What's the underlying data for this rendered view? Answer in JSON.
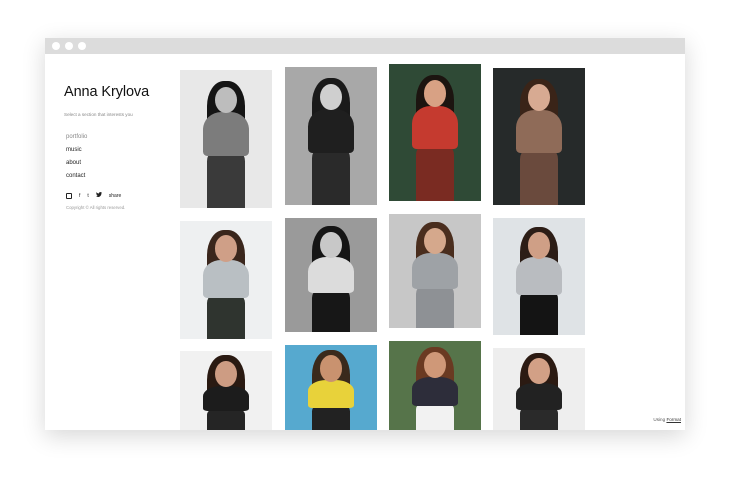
{
  "site": {
    "title": "Anna Krylova",
    "tagline": "Select a section that interests you"
  },
  "nav": {
    "items": [
      {
        "label": "portfolio",
        "active": true
      },
      {
        "label": "music",
        "active": false
      },
      {
        "label": "about",
        "active": false
      },
      {
        "label": "contact",
        "active": false
      }
    ]
  },
  "social": {
    "icons": [
      "instagram-icon",
      "facebook-icon",
      "tumblr-icon",
      "twitter-icon"
    ],
    "facebook_glyph": "f",
    "tumblr_glyph": "t",
    "share_label": "share"
  },
  "copyright": "Copyright © All rights reserved.",
  "footer": {
    "using_label": "Using",
    "platform_link": "Format"
  },
  "gallery": {
    "photos": [
      {
        "bg": "#e8e8e8",
        "body": "#7c7c7c",
        "legs": "#3a3a3a",
        "hair": "#151515",
        "skin": "#bdbdbd"
      },
      {
        "bg": "#a8a8a8",
        "body": "#1f1f1f",
        "legs": "#2a2a2a",
        "hair": "#1a1a1a",
        "skin": "#cfcfcf"
      },
      {
        "bg": "#2f4a36",
        "body": "#c53a2f",
        "legs": "#7a2b22",
        "hair": "#1c1410",
        "skin": "#d8a184"
      },
      {
        "bg": "#262a2a",
        "body": "#8f6b58",
        "legs": "#6a4a3d",
        "hair": "#3a2418",
        "skin": "#d7aa92"
      },
      {
        "bg": "#eef0f1",
        "body": "#b9bfc3",
        "legs": "#2f342f",
        "hair": "#3a261c",
        "skin": "#cf9f87"
      },
      {
        "bg": "#9a9a9a",
        "body": "#dcdcdc",
        "legs": "#171717",
        "hair": "#151515",
        "skin": "#c8c8c8"
      },
      {
        "bg": "#c7c7c7",
        "body": "#9ea2a6",
        "legs": "#8e9195",
        "hair": "#4a2e1e",
        "skin": "#d5a88c"
      },
      {
        "bg": "#dfe3e6",
        "body": "#b9bcc0",
        "legs": "#141414",
        "hair": "#2c1d16",
        "skin": "#cf9f86"
      },
      {
        "bg": "#f1f1f1",
        "body": "#1c1c1c",
        "legs": "#252525",
        "hair": "#2a1a12",
        "skin": "#cd9c83"
      },
      {
        "bg": "#56a9cf",
        "body": "#e8d23a",
        "legs": "#222222",
        "hair": "#3a2a1c",
        "skin": "#c9926f"
      },
      {
        "bg": "#56744a",
        "body": "#2d2d3a",
        "legs": "#f2f2f2",
        "hair": "#6a3a22",
        "skin": "#cf9878"
      },
      {
        "bg": "#eeeeee",
        "body": "#222222",
        "legs": "#2a2a2a",
        "hair": "#2b1a12",
        "skin": "#d2a086"
      }
    ]
  }
}
